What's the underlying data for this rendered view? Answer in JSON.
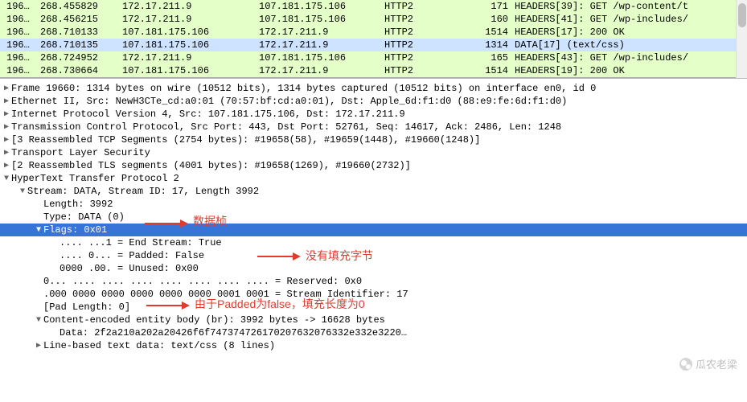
{
  "packets": [
    {
      "no": "196…",
      "time": "268.455829",
      "src": "172.17.211.9",
      "dst": "107.181.175.106",
      "proto": "HTTP2",
      "len": "171",
      "info": "HEADERS[39]: GET /wp-content/t",
      "cls": "green"
    },
    {
      "no": "196…",
      "time": "268.456215",
      "src": "172.17.211.9",
      "dst": "107.181.175.106",
      "proto": "HTTP2",
      "len": "160",
      "info": "HEADERS[41]: GET /wp-includes/",
      "cls": "green"
    },
    {
      "no": "196…",
      "time": "268.710133",
      "src": "107.181.175.106",
      "dst": "172.17.211.9",
      "proto": "HTTP2",
      "len": "1514",
      "info": "HEADERS[17]: 200 OK",
      "cls": "green"
    },
    {
      "no": "196…",
      "time": "268.710135",
      "src": "107.181.175.106",
      "dst": "172.17.211.9",
      "proto": "HTTP2",
      "len": "1314",
      "info": "DATA[17] (text/css)",
      "cls": "blue"
    },
    {
      "no": "196…",
      "time": "268.724952",
      "src": "172.17.211.9",
      "dst": "107.181.175.106",
      "proto": "HTTP2",
      "len": "165",
      "info": "HEADERS[43]: GET /wp-includes/",
      "cls": "green"
    },
    {
      "no": "196…",
      "time": "268.730664",
      "src": "107.181.175.106",
      "dst": "172.17.211.9",
      "proto": "HTTP2",
      "len": "1514",
      "info": "HEADERS[19]: 200 OK",
      "cls": "green"
    }
  ],
  "tree": [
    {
      "indent": 0,
      "arrow": "right",
      "text": "Frame 19660: 1314 bytes on wire (10512 bits), 1314 bytes captured (10512 bits) on interface en0, id 0"
    },
    {
      "indent": 0,
      "arrow": "right",
      "text": "Ethernet II, Src: NewH3CTe_cd:a0:01 (70:57:bf:cd:a0:01), Dst: Apple_6d:f1:d0 (88:e9:fe:6d:f1:d0)"
    },
    {
      "indent": 0,
      "arrow": "right",
      "text": "Internet Protocol Version 4, Src: 107.181.175.106, Dst: 172.17.211.9"
    },
    {
      "indent": 0,
      "arrow": "right",
      "text": "Transmission Control Protocol, Src Port: 443, Dst Port: 52761, Seq: 14617, Ack: 2486, Len: 1248"
    },
    {
      "indent": 0,
      "arrow": "right",
      "text": "[3 Reassembled TCP Segments (2754 bytes): #19658(58), #19659(1448), #19660(1248)]"
    },
    {
      "indent": 0,
      "arrow": "right",
      "text": "Transport Layer Security"
    },
    {
      "indent": 0,
      "arrow": "right",
      "text": "[2 Reassembled TLS segments (4001 bytes): #19658(1269), #19660(2732)]"
    },
    {
      "indent": 0,
      "arrow": "down",
      "text": "HyperText Transfer Protocol 2"
    },
    {
      "indent": 1,
      "arrow": "down",
      "text": "Stream: DATA, Stream ID: 17, Length 3992"
    },
    {
      "indent": 2,
      "arrow": "none",
      "text": "Length: 3992"
    },
    {
      "indent": 2,
      "arrow": "none",
      "text": "Type: DATA (0)"
    },
    {
      "indent": 2,
      "arrow": "down",
      "text": "Flags: 0x01",
      "sel": true
    },
    {
      "indent": 3,
      "arrow": "none",
      "text": ".... ...1 = End Stream: True"
    },
    {
      "indent": 3,
      "arrow": "none",
      "text": ".... 0... = Padded: False"
    },
    {
      "indent": 3,
      "arrow": "none",
      "text": "0000 .00. = Unused: 0x00"
    },
    {
      "indent": 2,
      "arrow": "none",
      "text": "0... .... .... .... .... .... .... .... = Reserved: 0x0"
    },
    {
      "indent": 2,
      "arrow": "none",
      "text": ".000 0000 0000 0000 0000 0000 0001 0001 = Stream Identifier: 17"
    },
    {
      "indent": 2,
      "arrow": "none",
      "text": "[Pad Length: 0]"
    },
    {
      "indent": 2,
      "arrow": "down",
      "text": "Content-encoded entity body (br): 3992 bytes -> 16628 bytes"
    },
    {
      "indent": 3,
      "arrow": "none",
      "text": "Data: 2f2a210a202a20426f6f747374726170207632076332e332e3220…"
    },
    {
      "indent": 2,
      "arrow": "right",
      "text": "Line-based text data: text/css (8 lines)"
    }
  ],
  "annotations": {
    "a1": "数据桢",
    "a2": "没有填充字节",
    "a3": "由于Padded为false，填充长度为0"
  },
  "watermark": "瓜农老梁"
}
